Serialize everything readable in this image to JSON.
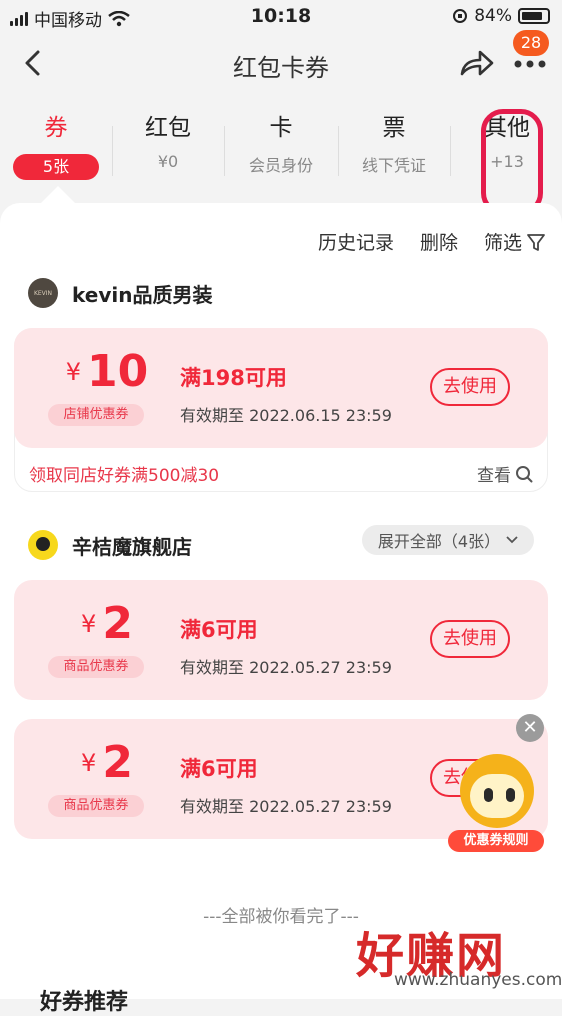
{
  "status": {
    "carrier": "中国移动",
    "time": "10:18",
    "battery": "84%"
  },
  "nav": {
    "title": "红包卡券",
    "badge": "28"
  },
  "tabs": [
    {
      "name": "券",
      "sub": "5张"
    },
    {
      "name": "红包",
      "sub": "¥0"
    },
    {
      "name": "卡",
      "sub": "会员身份"
    },
    {
      "name": "票",
      "sub": "线下凭证"
    },
    {
      "name": "其他",
      "sub": "+13"
    }
  ],
  "toolbar": {
    "history": "历史记录",
    "delete": "删除",
    "filter": "筛选"
  },
  "shops": [
    {
      "name": "kevin品质男装",
      "logo_text": "KEVIN",
      "coupon": {
        "currency": "¥",
        "amount": "10",
        "type": "店铺优惠券",
        "condition": "满198可用",
        "validity": "有效期至 2022.06.15 23:59",
        "action": "去使用"
      },
      "promo": "领取同店好券满500减30",
      "check": "查看"
    },
    {
      "name": "辛桔魔旗舰店",
      "expand": "展开全部（4张）",
      "coupons": [
        {
          "currency": "¥",
          "amount": "2",
          "type": "商品优惠券",
          "condition": "满6可用",
          "validity": "有效期至 2022.05.27 23:59",
          "action": "去使用"
        },
        {
          "currency": "¥",
          "amount": "2",
          "type": "商品优惠券",
          "condition": "满6可用",
          "validity": "有效期至 2022.05.27 23:59",
          "action": "去使用"
        }
      ]
    }
  ],
  "floating": {
    "label": "优惠券规则"
  },
  "end_text": "---全部被你看完了---",
  "recommend_title": "好券推荐",
  "watermark": {
    "main": "好赚网",
    "url": "www.zhuanyes.com"
  }
}
